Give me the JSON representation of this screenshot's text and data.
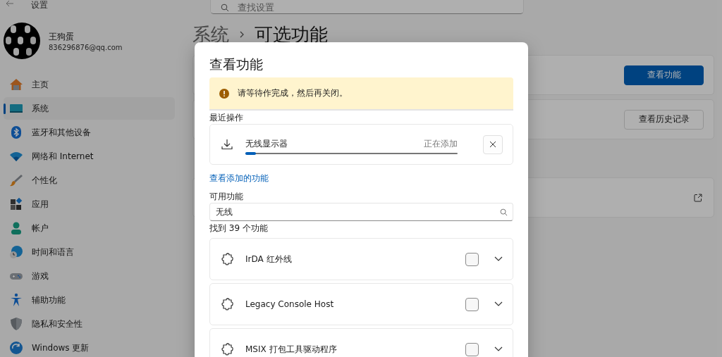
{
  "window": {
    "title": "设置"
  },
  "search": {
    "placeholder": "查找设置"
  },
  "profile": {
    "name": "王狗蛋",
    "email": "836296876@qq.com"
  },
  "sidebar": {
    "items": [
      {
        "label": "主页",
        "selected": false
      },
      {
        "label": "系统",
        "selected": true
      },
      {
        "label": "蓝牙和其他设备",
        "selected": false
      },
      {
        "label": "网络和 Internet",
        "selected": false
      },
      {
        "label": "个性化",
        "selected": false
      },
      {
        "label": "应用",
        "selected": false
      },
      {
        "label": "帐户",
        "selected": false
      },
      {
        "label": "时间和语言",
        "selected": false
      },
      {
        "label": "游戏",
        "selected": false
      },
      {
        "label": "辅助功能",
        "selected": false
      },
      {
        "label": "隐私和安全性",
        "selected": false
      },
      {
        "label": "Windows 更新",
        "selected": false
      }
    ]
  },
  "breadcrumb": {
    "parent": "系统",
    "current": "可选功能"
  },
  "settings_cards": [
    {
      "kind": "button",
      "button": "查看功能",
      "primary": true
    },
    {
      "kind": "button",
      "button": "查看历史记录",
      "primary": false
    },
    {
      "kind": "external_link"
    }
  ],
  "dialog": {
    "title": "查看功能",
    "warning": "请等待作完成，然后再关闭。",
    "recent": {
      "heading": "最近操作",
      "items": [
        {
          "name": "无线显示器",
          "status": "正在添加",
          "level": 0.05
        }
      ]
    },
    "link": "查看添加的功能",
    "available": {
      "heading": "可用功能",
      "search": {
        "value": "无线"
      },
      "count": "找到 39 个功能",
      "features": [
        {
          "name": "IrDA 红外线",
          "checked": false,
          "expanded": false
        },
        {
          "name": "Legacy Console Host",
          "checked": false,
          "expanded": false
        },
        {
          "name": "MSIX 打包工具驱动程序",
          "checked": false,
          "expanded": false
        }
      ]
    }
  }
}
